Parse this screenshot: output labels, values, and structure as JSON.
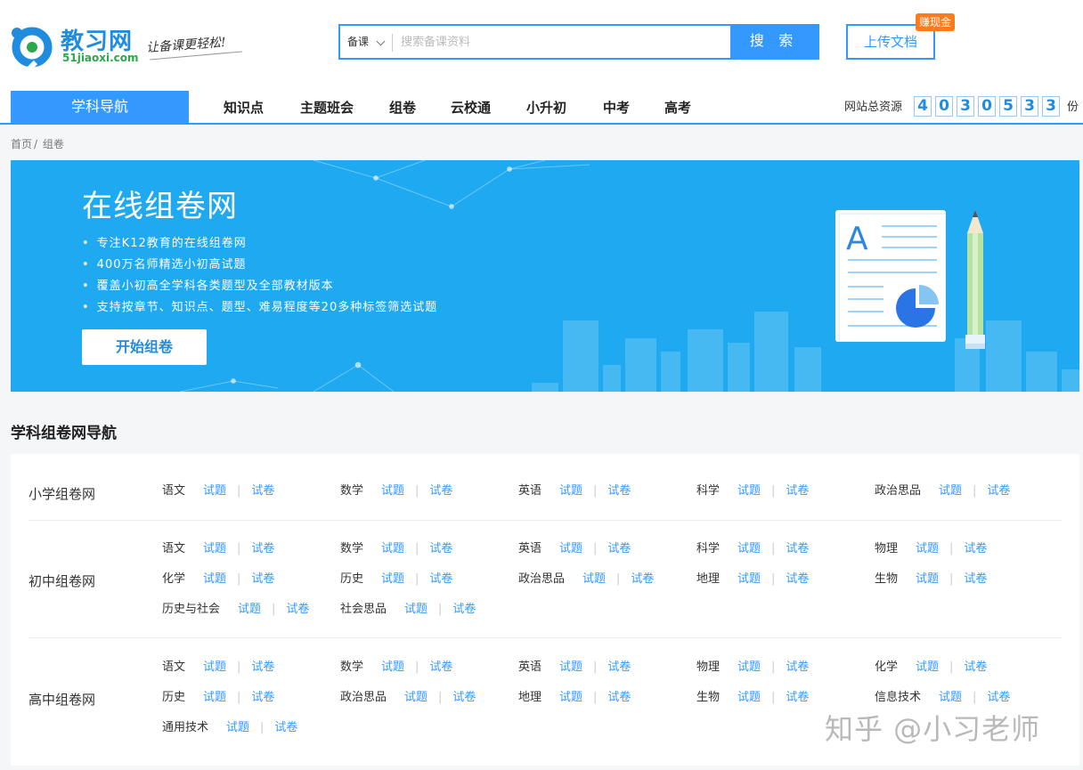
{
  "brand": {
    "name": "教习网",
    "domain": "51jiaoxi.com",
    "slogan": "让备课更轻松!"
  },
  "search": {
    "category": "备课",
    "placeholder": "搜索备课资料",
    "button_label": "搜 索"
  },
  "upload": {
    "label": "上传文档",
    "badge": "赚现金"
  },
  "nav": {
    "main": "学科导航",
    "items": [
      "知识点",
      "主题班会",
      "组卷",
      "云校通",
      "小升初",
      "中考",
      "高考"
    ],
    "resource_label": "网站总资源",
    "resource_digits": [
      "4",
      "0",
      "3",
      "0",
      "5",
      "3",
      "3"
    ],
    "resource_unit": "份"
  },
  "breadcrumb": [
    "首页",
    "/",
    "组卷"
  ],
  "banner": {
    "title": "在线组卷网",
    "points": [
      "专注K12教育的在线组卷网",
      "400万名师精选小初高试题",
      "覆盖小初高全学科各类题型及全部教材版本",
      "支持按章节、知识点、题型、难易程度等20多种标签筛选试题"
    ],
    "cta": "开始组卷",
    "colors": {
      "background": "#1ea9f0",
      "accent": "#3399ff"
    }
  },
  "section_title": "学科组卷网导航",
  "link_question": "试题",
  "link_paper": "试卷",
  "groups": [
    {
      "title": "小学组卷网",
      "rows": [
        [
          "语文",
          "数学",
          "英语",
          "科学",
          "政治思品"
        ]
      ]
    },
    {
      "title": "初中组卷网",
      "rows": [
        [
          "语文",
          "数学",
          "英语",
          "科学",
          "物理"
        ],
        [
          "化学",
          "历史",
          "政治思品",
          "地理",
          "生物"
        ],
        [
          "历史与社会",
          "社会思品"
        ]
      ]
    },
    {
      "title": "高中组卷网",
      "rows": [
        [
          "语文",
          "数学",
          "英语",
          "物理",
          "化学"
        ],
        [
          "历史",
          "政治思品",
          "地理",
          "生物",
          "信息技术"
        ],
        [
          "通用技术"
        ]
      ]
    }
  ],
  "watermark": "知乎 @小习老师"
}
